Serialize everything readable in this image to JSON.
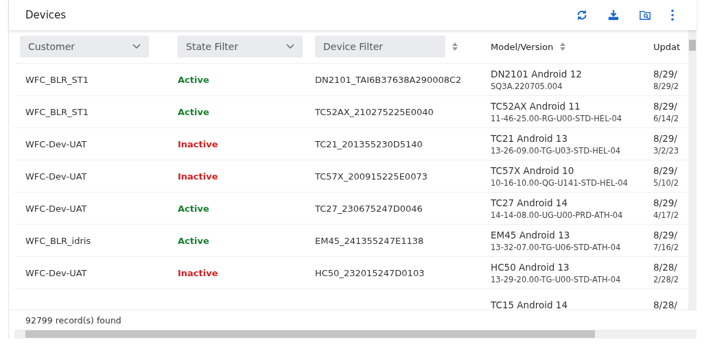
{
  "title": "Devices",
  "toolbar": [
    {
      "kind": "refresh"
    },
    {
      "kind": "download"
    },
    {
      "kind": "folder-search"
    },
    {
      "kind": "more"
    }
  ],
  "columns": [
    {
      "kind": "dropdown",
      "label": "Customer"
    },
    {
      "kind": "dropdown",
      "label": "State Filter"
    },
    {
      "kind": "input",
      "placeholder": "Device Filter"
    },
    {
      "kind": "sort",
      "label": "Model/Version"
    },
    {
      "kind": "plain",
      "label": "Updat"
    }
  ],
  "rows": [
    {
      "customer": "WFC_BLR_ST1",
      "state": "Active",
      "active": true,
      "device": "DN2101_TAI6B37638A290008C2",
      "model": "DN2101 Android 12",
      "version": "SQ3A.220705.004",
      "updated": "8/29/",
      "updated_2": "8/29/2"
    },
    {
      "customer": "WFC_BLR_ST1",
      "state": "Active",
      "active": true,
      "device": "TC52AX_210275225E0040",
      "model": "TC52AX Android 11",
      "version": "11-46-25.00-RG-U00-STD-HEL-04",
      "updated": "8/29/",
      "updated_2": "6/14/2"
    },
    {
      "customer": "WFC-Dev-UAT",
      "state": "Inactive",
      "active": false,
      "device": "TC21_201355230D5140",
      "model": "TC21 Android 13",
      "version": "13-26-09.00-TG-U03-STD-HEL-04",
      "updated": "8/29/",
      "updated_2": "3/2/23"
    },
    {
      "customer": "WFC-Dev-UAT",
      "state": "Inactive",
      "active": false,
      "device": "TC57X_200915225E0073",
      "model": "TC57X Android 10",
      "version": "10-16-10.00-QG-U141-STD-HEL-04",
      "updated": "8/29/",
      "updated_2": "5/10/2"
    },
    {
      "customer": "WFC-Dev-UAT",
      "state": "Active",
      "active": true,
      "device": "TC27_230675247D0046",
      "model": "TC27 Android 14",
      "version": "14-14-08.00-UG-U00-PRD-ATH-04",
      "updated": "8/29/",
      "updated_2": "4/17/2"
    },
    {
      "customer": "WFC_BLR_idris",
      "state": "Active",
      "active": true,
      "device": "EM45_241355247E1138",
      "model": "EM45 Android 13",
      "version": "13-32-07.00-TG-U06-STD-ATH-04",
      "updated": "8/29/",
      "updated_2": "7/16/2"
    },
    {
      "customer": "WFC-Dev-UAT",
      "state": "Inactive",
      "active": false,
      "device": "HC50_232015247D0103",
      "model": "HC50 Android 13",
      "version": "13-29-20.00-TG-U00-STD-ATH-04",
      "updated": "8/28/",
      "updated_2": "2/28/2"
    },
    {
      "model": "TC15 Android 14",
      "updated": "8/28/"
    }
  ],
  "footer": "92799 record(s) found"
}
